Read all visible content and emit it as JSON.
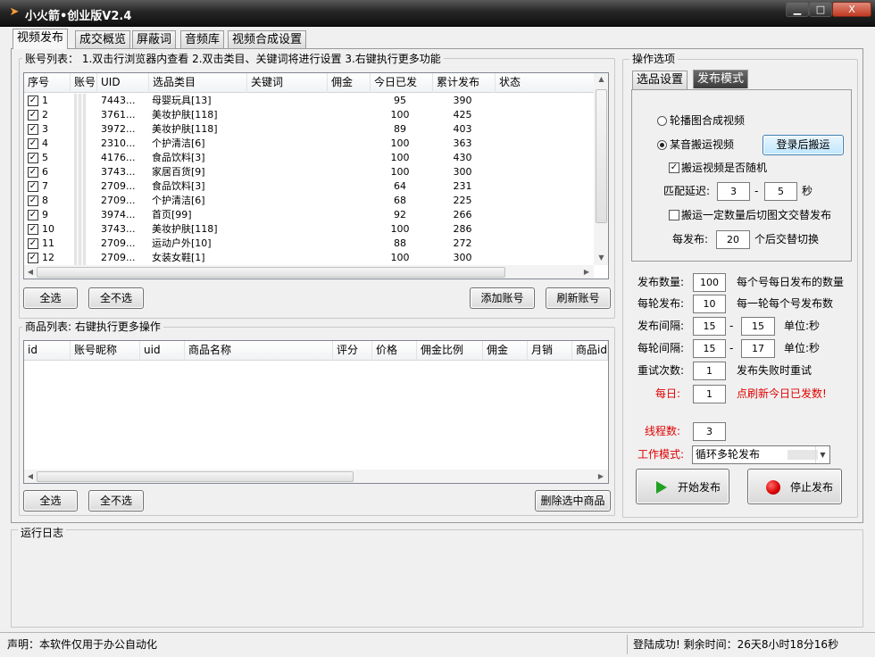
{
  "window": {
    "title": "小火箭•创业版V2.4",
    "controls": {
      "minimize": "▁",
      "maximize": "□",
      "close": "X"
    }
  },
  "main_tabs": [
    "视频发布",
    "成交概览",
    "屏蔽词",
    "音频库",
    "视频合成设置"
  ],
  "accounts": {
    "group_label": "账号列表：  1.双击行浏览器内查看   2.双击类目、关键词将进行设置  3.右键执行更多功能",
    "columns": [
      "序号",
      "账号",
      "UID",
      "选品类目",
      "关键词",
      "佣金",
      "今日已发",
      "累计发布",
      "状态"
    ],
    "rows": [
      {
        "no": "1",
        "uid": "7443...",
        "category": "母婴玩具[13]",
        "today": "95",
        "total": "390"
      },
      {
        "no": "2",
        "uid": "3761...",
        "category": "美妆护肤[118]",
        "today": "100",
        "total": "425"
      },
      {
        "no": "3",
        "uid": "3972...",
        "category": "美妆护肤[118]",
        "today": "89",
        "total": "403"
      },
      {
        "no": "4",
        "uid": "2310...",
        "category": "个护清洁[6]",
        "today": "100",
        "total": "363"
      },
      {
        "no": "5",
        "uid": "4176...",
        "category": "食品饮料[3]",
        "today": "100",
        "total": "430"
      },
      {
        "no": "6",
        "uid": "3743...",
        "category": "家居百货[9]",
        "today": "100",
        "total": "300"
      },
      {
        "no": "7",
        "uid": "2709...",
        "category": "食品饮料[3]",
        "today": "64",
        "total": "231"
      },
      {
        "no": "8",
        "uid": "2709...",
        "category": "个护清洁[6]",
        "today": "68",
        "total": "225"
      },
      {
        "no": "9",
        "uid": "3974...",
        "category": "首页[99]",
        "today": "92",
        "total": "266"
      },
      {
        "no": "10",
        "uid": "3743...",
        "category": "美妆护肤[118]",
        "today": "100",
        "total": "286"
      },
      {
        "no": "11",
        "uid": "2709...",
        "category": "运动户外[10]",
        "today": "88",
        "total": "272"
      },
      {
        "no": "12",
        "uid": "2709...",
        "category": "女装女鞋[1]",
        "today": "100",
        "total": "300"
      }
    ],
    "buttons": {
      "select_all": "全选",
      "select_none": "全不选",
      "add": "添加账号",
      "refresh": "刷新账号"
    }
  },
  "products": {
    "group_label": "商品列表:   右键执行更多操作",
    "columns": [
      "id",
      "账号昵称",
      "uid",
      "商品名称",
      "评分",
      "价格",
      "佣金比例",
      "佣金",
      "月销",
      "商品id"
    ],
    "buttons": {
      "select_all": "全选",
      "select_none": "全不选",
      "delete": "删除选中商品"
    }
  },
  "ops": {
    "group_label": "操作选项",
    "tabs": [
      "选品设置",
      "发布模式"
    ],
    "radio_carousel": "轮播图合成视频",
    "radio_douyin": "某音搬运视频",
    "login_button": "登录后搬运",
    "random_label": "搬运视频是否随机",
    "match_delay_label": "匹配延迟:",
    "match_delay_min": "3",
    "match_delay_max": "5",
    "match_delay_unit": "秒",
    "switch_label": "搬运一定数量后切图文交替发布",
    "switch_prefix": "每发布:",
    "switch_value": "20",
    "switch_suffix": "个后交替切换",
    "dash": "-"
  },
  "settings": [
    {
      "label": "发布数量:",
      "value": "100",
      "hint": "每个号每日发布的数量"
    },
    {
      "label": "每轮发布:",
      "value": "10",
      "hint": "每一轮每个号发布数"
    },
    {
      "label": "发布间隔:",
      "value": "15",
      "value2": "15",
      "hint": "单位:秒"
    },
    {
      "label": "每轮间隔:",
      "value": "15",
      "value2": "17",
      "hint": "单位:秒"
    },
    {
      "label": "重试次数:",
      "value": "1",
      "hint": "发布失败时重试"
    },
    {
      "label": "每日:",
      "value": "1",
      "hint": "点刷新今日已发数!"
    }
  ],
  "threads": {
    "label": "线程数:",
    "value": "3"
  },
  "work_mode": {
    "label": "工作模式:",
    "value": "循环多轮发布"
  },
  "actions": {
    "start": "开始发布",
    "stop": "停止发布"
  },
  "log": {
    "label": "运行日志"
  },
  "status": {
    "left": "声明：本软件仅用于办公自动化",
    "right": "登陆成功! 剩余时间：26天8小时18分16秒"
  },
  "colors": {
    "accent_red": "#e00000",
    "start_green": "#22a022",
    "stop_red": "#d80000"
  }
}
